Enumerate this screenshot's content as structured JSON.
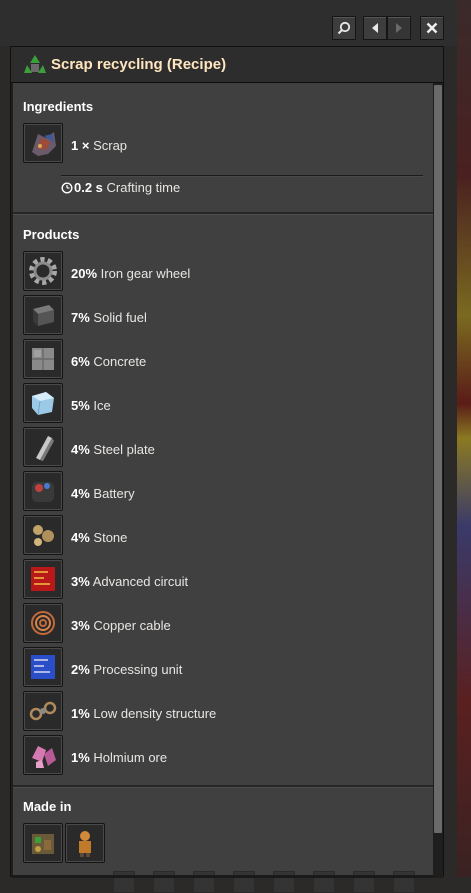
{
  "header": {
    "title": "Scrap recycling (Recipe)"
  },
  "ingredients": {
    "title": "Ingredients",
    "items": [
      {
        "amount": "1 ×",
        "name": "Scrap"
      }
    ],
    "crafting_time_value": "0.2 s",
    "crafting_time_label": "Crafting time"
  },
  "products": {
    "title": "Products",
    "items": [
      {
        "pct": "20%",
        "name": "Iron gear wheel",
        "icon": "iron-gear-wheel-icon",
        "color": "#9a9a9a"
      },
      {
        "pct": "7%",
        "name": "Solid fuel",
        "icon": "solid-fuel-icon",
        "color": "#5a5a5a"
      },
      {
        "pct": "6%",
        "name": "Concrete",
        "icon": "concrete-icon",
        "color": "#8a8a8a"
      },
      {
        "pct": "5%",
        "name": "Ice",
        "icon": "ice-icon",
        "color": "#9cc9e6"
      },
      {
        "pct": "4%",
        "name": "Steel plate",
        "icon": "steel-plate-icon",
        "color": "#b8b8b8"
      },
      {
        "pct": "4%",
        "name": "Battery",
        "icon": "battery-icon",
        "color": "#c04040"
      },
      {
        "pct": "4%",
        "name": "Stone",
        "icon": "stone-icon",
        "color": "#c2a36a"
      },
      {
        "pct": "3%",
        "name": "Advanced circuit",
        "icon": "advanced-circuit-icon",
        "color": "#c62020"
      },
      {
        "pct": "3%",
        "name": "Copper cable",
        "icon": "copper-cable-icon",
        "color": "#c46a3a"
      },
      {
        "pct": "2%",
        "name": "Processing unit",
        "icon": "processing-unit-icon",
        "color": "#2a4ec8"
      },
      {
        "pct": "1%",
        "name": "Low density structure",
        "icon": "low-density-structure-icon",
        "color": "#b08a5a"
      },
      {
        "pct": "1%",
        "name": "Holmium ore",
        "icon": "holmium-ore-icon",
        "color": "#d47ab0"
      }
    ]
  },
  "made_in": {
    "title": "Made in"
  }
}
